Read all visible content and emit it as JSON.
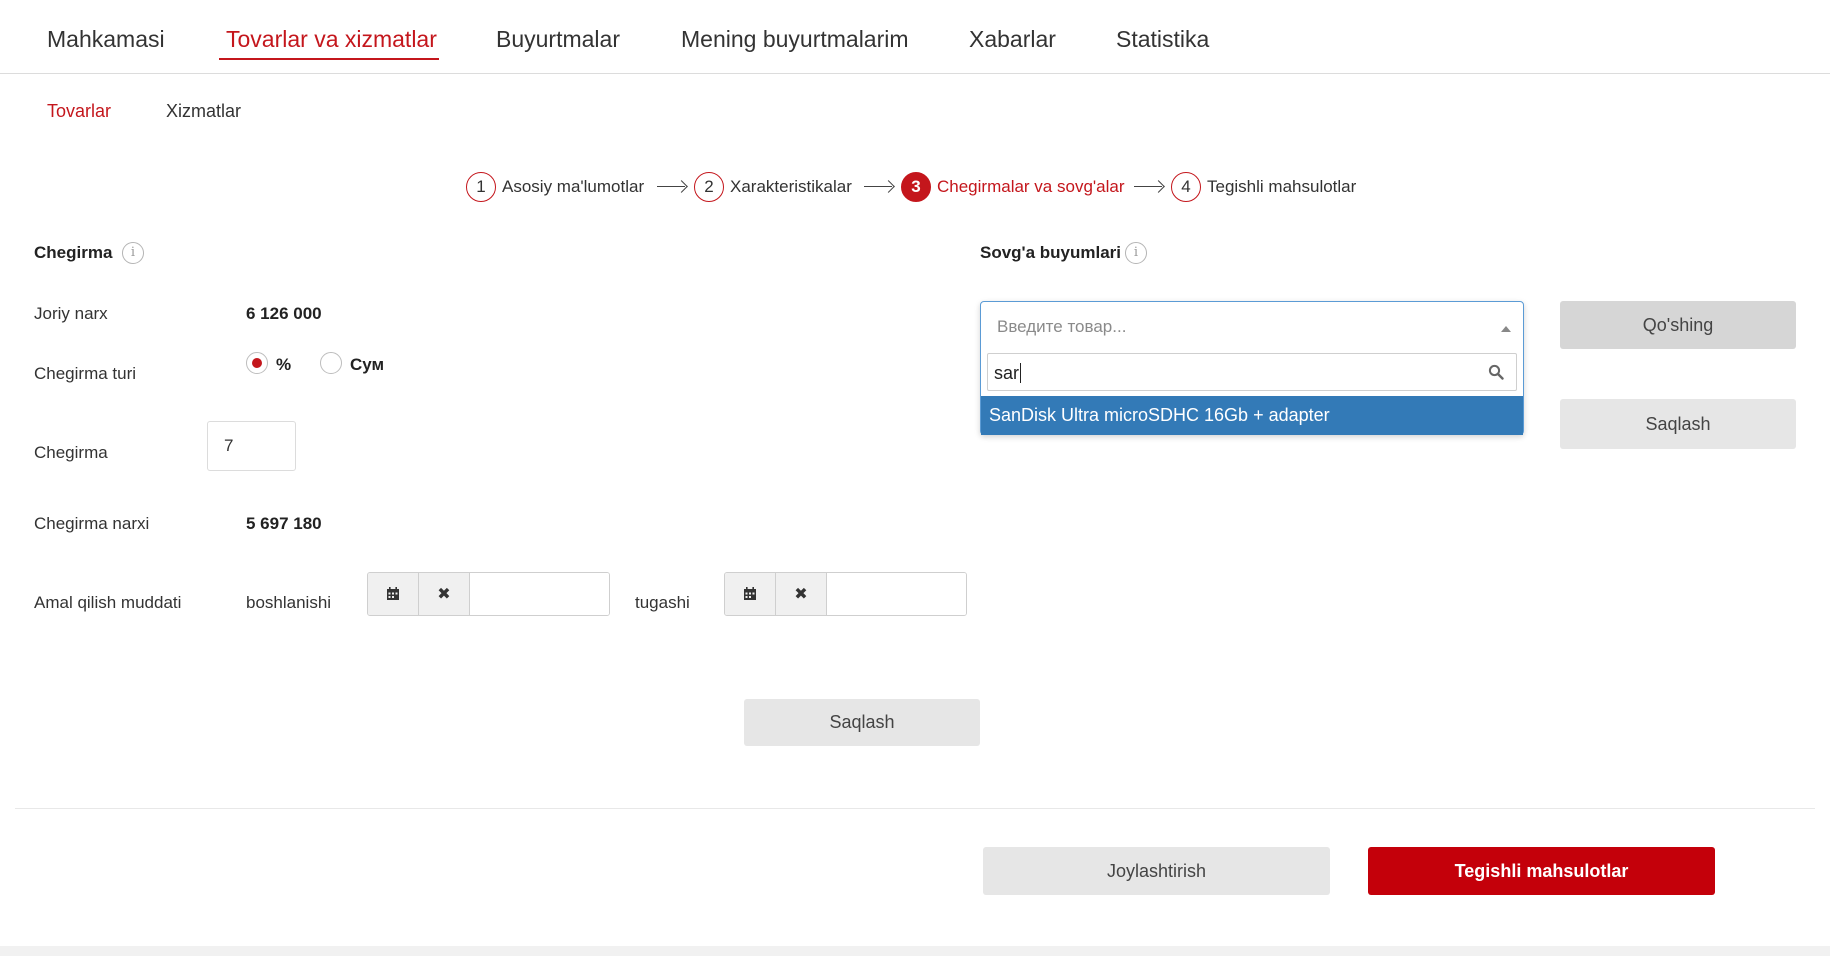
{
  "topnav": {
    "items": [
      {
        "label": "Mahkamasi"
      },
      {
        "label": "Tovarlar va xizmatlar",
        "active": true
      },
      {
        "label": "Buyurtmalar"
      },
      {
        "label": "Mening buyurtmalarim"
      },
      {
        "label": "Xabarlar"
      },
      {
        "label": "Statistika"
      }
    ]
  },
  "subnav": {
    "items": [
      {
        "label": "Tovarlar",
        "active": true
      },
      {
        "label": "Xizmatlar"
      }
    ]
  },
  "stepper": {
    "steps": [
      {
        "number": "1",
        "label": "Asosiy ma'lumotlar"
      },
      {
        "number": "2",
        "label": "Xarakteristikalar"
      },
      {
        "number": "3",
        "label": "Chegirmalar va sovg'alar",
        "active": true
      },
      {
        "number": "4",
        "label": "Tegishli mahsulotlar"
      }
    ]
  },
  "discount": {
    "title": "Chegirma",
    "info_icon": "i",
    "current_price_label": "Joriy narx",
    "current_price_value": "6 126 000",
    "type_label": "Chegirma turi",
    "type_options": [
      {
        "label": "%",
        "checked": true
      },
      {
        "label": "Сум",
        "checked": false
      }
    ],
    "amount_label": "Chegirma",
    "amount_value": "7",
    "discount_price_label": "Chegirma narxi",
    "discount_price_value": "5 697 180",
    "period_label": "Amal qilish muddati",
    "start_label": "boshlanishi",
    "end_label": "tugashi",
    "calendar_icon": "calendar-icon",
    "clear_icon": "✖",
    "save_label": "Saqlash"
  },
  "gifts": {
    "title": "Sovg'a buyumlari",
    "info_icon": "i",
    "select_placeholder": "Введите товар...",
    "search_value": "sar",
    "option": "SanDisk Ultra microSDHC 16Gb + adapter",
    "add_label": "Qo'shing",
    "save_label": "Saqlash"
  },
  "footer": {
    "place_label": "Joylashtirish",
    "next_label": "Tegishli mahsulotlar"
  },
  "colors": {
    "accent": "#c4161c",
    "selected_option": "#337ab7"
  }
}
